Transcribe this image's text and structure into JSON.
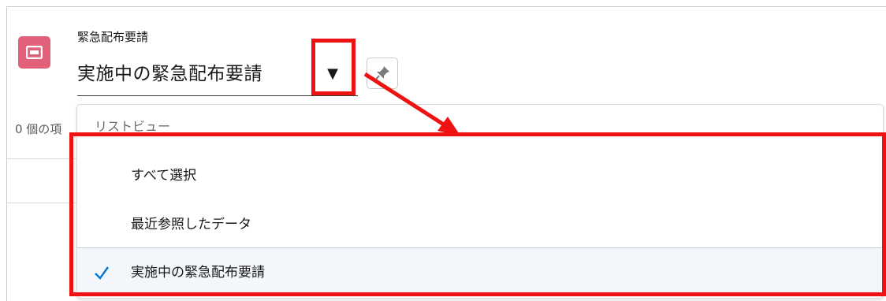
{
  "header": {
    "object_label": "緊急配布要請",
    "list_view_title": "実施中の緊急配布要請",
    "caret_icon": "▼",
    "pin_icon": "pin-icon"
  },
  "list": {
    "count_text": "0 個の項"
  },
  "dropdown": {
    "header": "リストビュー",
    "items": [
      {
        "label": "すべて選択",
        "selected": false
      },
      {
        "label": "最近参照したデータ",
        "selected": false
      },
      {
        "label": "実施中の緊急配布要請",
        "selected": true
      }
    ]
  },
  "colors": {
    "object_icon_bg": "#e2617a",
    "annotation_red": "#ee1212",
    "check": "#0176d3",
    "selected_bg": "#f3f7fb"
  }
}
